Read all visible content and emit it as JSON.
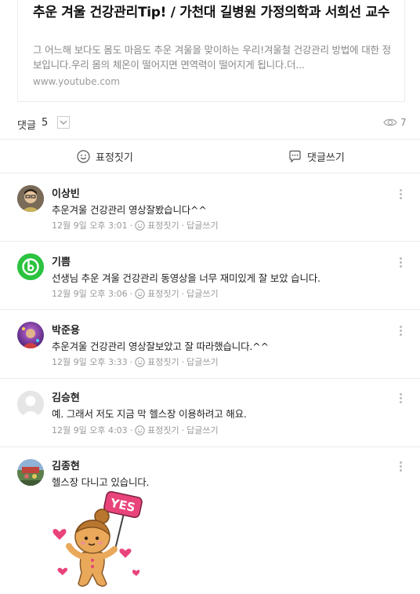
{
  "link_card": {
    "title": "추운 겨울 건강관리Tip! / 가천대 길병원 가정의학과 서희선 교수",
    "description": "그 어느해 보다도 몸도 마음도 추운 겨울을 맞이하는 우리!겨울철 건강관리 방법에 대한 정보입니다.우리 몸의 체온이 떨어지면 면역력이 떨어지게 됩니다.더...",
    "url": "www.youtube.com"
  },
  "comment_bar": {
    "label": "댓글",
    "count": "5",
    "views": "7"
  },
  "actions": {
    "emoji_label": "표정짓기",
    "reply_label": "댓글쓰기"
  },
  "comments": [
    {
      "name": "이상빈",
      "text": "추운겨울 건강관리 영상잘봤습니다^^",
      "time": "12월 9일 오후 3:01",
      "emoji": "표정짓기",
      "reply": "답글쓰기"
    },
    {
      "name": "기쁨",
      "text": "선생님  추운 겨울 건강관리 동영상을 너무 재미있게 잘 보았 습니다.",
      "time": "12월 9일 오후 3:06",
      "emoji": "표정짓기",
      "reply": "답글쓰기"
    },
    {
      "name": "박준용",
      "text": "추운겨울 건강관리 영상잘보았고 잘 따라했습니다.^^",
      "time": "12월 9일 오후 3:33",
      "emoji": "표정짓기",
      "reply": "답글쓰기"
    },
    {
      "name": "김승현",
      "text": "예. 그래서 저도 지금 막 헬스장 이용하려고 해요.",
      "time": "12월 9일 오후 4:03",
      "emoji": "표정짓기",
      "reply": "답글쓰기"
    },
    {
      "name": "김종현",
      "text": "헬스장 다니고 있습니다.",
      "sticker_text": "YES"
    }
  ],
  "colors": {
    "kibbeum_avatar": "#2bc33f",
    "sticker_pink": "#e8447a",
    "cookie": "#e9a85a"
  }
}
